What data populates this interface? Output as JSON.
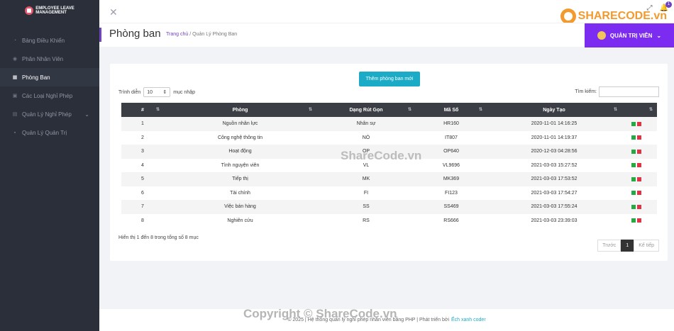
{
  "app": {
    "logo_line1": "Employee Leave",
    "logo_line2": "Management"
  },
  "sidebar": {
    "items": [
      {
        "label": "Bảng Điều Khiển",
        "icon": "dashboard-icon",
        "active": false
      },
      {
        "label": "Phân Nhân Viên",
        "icon": "users-icon",
        "active": false
      },
      {
        "label": "Phòng Ban",
        "icon": "grid-icon",
        "active": true
      },
      {
        "label": "Các Loại Nghỉ Phép",
        "icon": "calendar-icon",
        "active": false
      },
      {
        "label": "Quản Lý Nghỉ Phép",
        "icon": "folder-icon",
        "active": false
      },
      {
        "label": "Quản Lý Quản Trị",
        "icon": "lock-icon",
        "active": false
      }
    ]
  },
  "topbar": {
    "notification_count": "1"
  },
  "header": {
    "title": "Phòng ban",
    "breadcrumb_home": "Trang chủ",
    "breadcrumb_sep": "/",
    "breadcrumb_current": "Quản Lý Phòng Ban",
    "admin_label": "QUẢN TRỊ VIÊN"
  },
  "toolbar": {
    "add_label": "Thêm phòng ban mới",
    "show_prefix": "Trình diễn",
    "show_value": "10",
    "show_suffix": "mục nhập",
    "search_label": "Tìm kiếm:",
    "search_value": ""
  },
  "table": {
    "columns": [
      "#",
      "Phòng",
      "Dạng Rút Gọn",
      "Mã Số",
      "Ngày Tạo",
      ""
    ],
    "rows": [
      {
        "no": "1",
        "name": "Nguồn nhân lực",
        "short": "Nhân sự",
        "code": "HR160",
        "created": "2020-11-01 14:16:25"
      },
      {
        "no": "2",
        "name": "Công nghệ thông tin",
        "short": "NÓ",
        "code": "IT807",
        "created": "2020-11-01 14:19:37"
      },
      {
        "no": "3",
        "name": "Hoạt động",
        "short": "OP",
        "code": "OP640",
        "created": "2020-12-03 04:28:56"
      },
      {
        "no": "4",
        "name": "Tình nguyện viên",
        "short": "VL",
        "code": "VL9696",
        "created": "2021-03-03 15:27:52"
      },
      {
        "no": "5",
        "name": "Tiếp thị",
        "short": "MK",
        "code": "MK369",
        "created": "2021-03-03 17:53:52"
      },
      {
        "no": "6",
        "name": "Tài chính",
        "short": "FI",
        "code": "FI123",
        "created": "2021-03-03 17:54:27"
      },
      {
        "no": "7",
        "name": "Việc bán hàng",
        "short": "SS",
        "code": "SS469",
        "created": "2021-03-03 17:55:24"
      },
      {
        "no": "8",
        "name": "Nghiên cứu",
        "short": "RS",
        "code": "RS666",
        "created": "2021-03-03 23:39:03"
      }
    ]
  },
  "pagination": {
    "info": "Hiển thị 1 đến 8 trong tổng số 8 mục",
    "prev": "Trước",
    "current": "1",
    "next": "Kế tiếp"
  },
  "footer": {
    "text": "© 2025 | Hệ thống quản lý nghỉ phép nhân viên bằng PHP | Phát triển bởi",
    "link": "Ếch xanh coder"
  },
  "watermarks": {
    "logo": "SHARECODE.vn",
    "mid": "ShareCode.vn",
    "foot": "Copyright © ShareCode.vn"
  }
}
